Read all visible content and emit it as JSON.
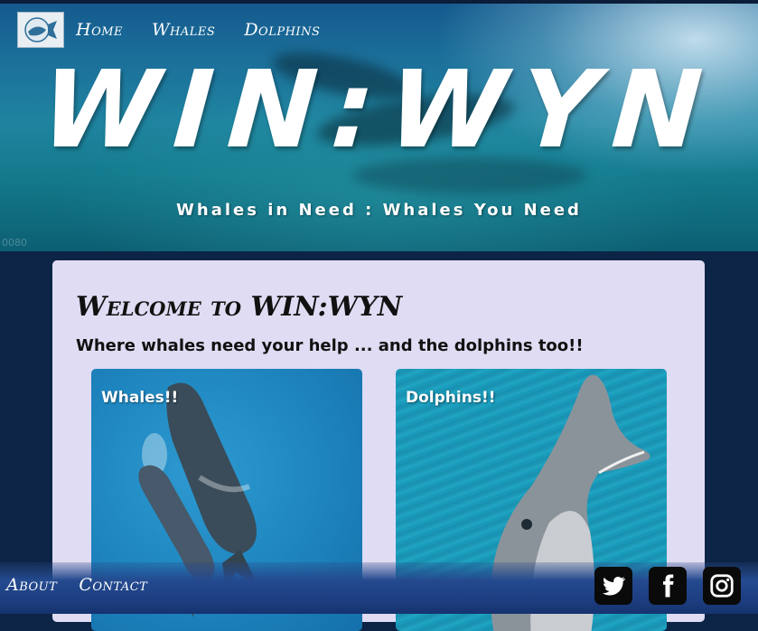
{
  "nav": {
    "home": "Home",
    "whales": "Whales",
    "dolphins": "Dolphins"
  },
  "hero": {
    "title": "WIN:WYN",
    "tagline": "Whales in Need : Whales You Need",
    "timestamp": "0080"
  },
  "main": {
    "welcome": "Welcome to WIN:WYN",
    "subhead": "Where whales need your help ... and the dolphins too!!",
    "tiles": [
      {
        "label": "Whales!!"
      },
      {
        "label": "Dolphins!!"
      }
    ]
  },
  "footer": {
    "about": "About",
    "contact": "Contact",
    "social": [
      "twitter-icon",
      "facebook-icon",
      "instagram-icon"
    ]
  },
  "colors": {
    "page_bg": "#0c2445",
    "card_bg": "#e0dcf3",
    "footer_bg": "#244a8f"
  }
}
